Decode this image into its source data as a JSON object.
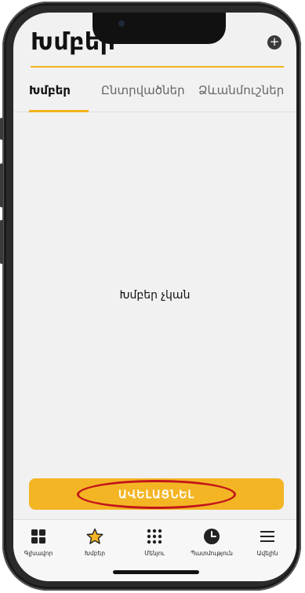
{
  "header": {
    "title": "Խմբեր",
    "add_icon": "plus-circle-icon"
  },
  "tabs": [
    {
      "label": "Խմբեր",
      "active": true
    },
    {
      "label": "Ընտրվածներ",
      "active": false
    },
    {
      "label": "Ձևանմուշներ",
      "active": false
    }
  ],
  "main": {
    "empty_message": "Խմբեր չկան"
  },
  "add_button": {
    "label": "ԱՎԵԼԱՑՆԵԼ"
  },
  "bottom_nav": [
    {
      "label": "Գլխավոր",
      "icon": "grid-icon"
    },
    {
      "label": "Խմբեր",
      "icon": "star-icon"
    },
    {
      "label": "Մենյու",
      "icon": "dots-grid-icon"
    },
    {
      "label": "Պատմություն",
      "icon": "history-icon"
    },
    {
      "label": "Ավելին",
      "icon": "menu-icon"
    }
  ],
  "colors": {
    "accent": "#f4b524",
    "highlight": "#c2141b",
    "background": "#f1f1f1"
  }
}
